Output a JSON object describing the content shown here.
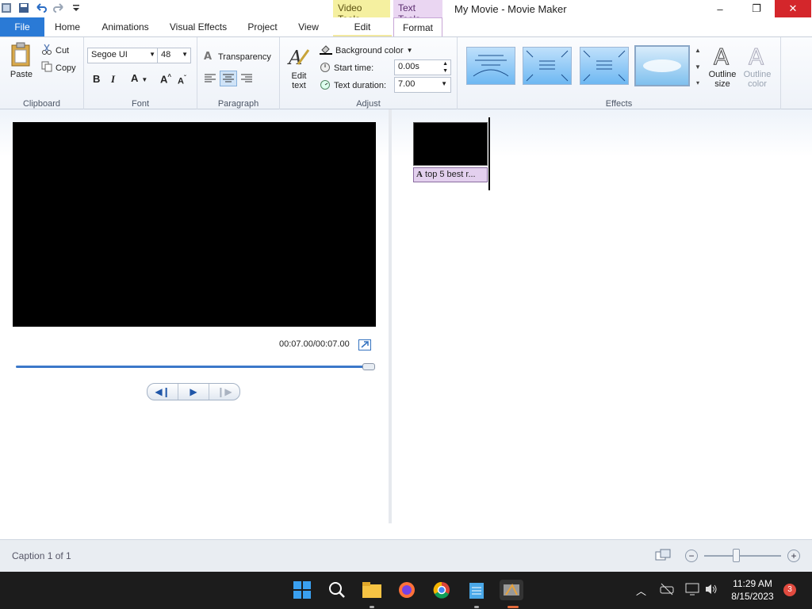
{
  "titlebar": {
    "app_title": "My Movie - Movie Maker",
    "context_video_tools": "Video Tools",
    "context_text_tools": "Text Tools",
    "minimize": "–",
    "maximize": "❐",
    "close": "✕"
  },
  "tabs": {
    "file": "File",
    "home": "Home",
    "animations": "Animations",
    "visual_effects": "Visual Effects",
    "project": "Project",
    "view": "View",
    "edit": "Edit",
    "format": "Format"
  },
  "ribbon": {
    "clipboard": {
      "paste": "Paste",
      "cut": "Cut",
      "copy": "Copy",
      "label": "Clipboard"
    },
    "font": {
      "family": "Segoe UI",
      "size": "48",
      "bold": "B",
      "italic": "I",
      "color": "A",
      "grow": "A",
      "shrink": "A",
      "label": "Font"
    },
    "paragraph": {
      "transparency": "Transparency",
      "label": "Paragraph"
    },
    "adjust": {
      "edit_text_line1": "Edit",
      "edit_text_line2": "text",
      "background_color": "Background color",
      "start_time_label": "Start time:",
      "start_time_value": "0.00s",
      "duration_label": "Text duration:",
      "duration_value": "7.00",
      "label": "Adjust"
    },
    "effects": {
      "outline_size_line1": "Outline",
      "outline_size_line2": "size",
      "outline_color_line1": "Outline",
      "outline_color_line2": "color",
      "label": "Effects"
    }
  },
  "preview": {
    "timecode": "00:07.00/00:07.00"
  },
  "storyboard": {
    "caption_clip": "top 5 best r..."
  },
  "status": {
    "caption_count": "Caption 1 of 1"
  },
  "taskbar": {
    "time": "11:29 AM",
    "date": "8/15/2023",
    "notifications": "3"
  },
  "colors": {
    "file_tab": "#2a7ad6",
    "video_tools": "#f5f0a0",
    "text_tools": "#ead6f2",
    "close_button": "#d4262b"
  }
}
